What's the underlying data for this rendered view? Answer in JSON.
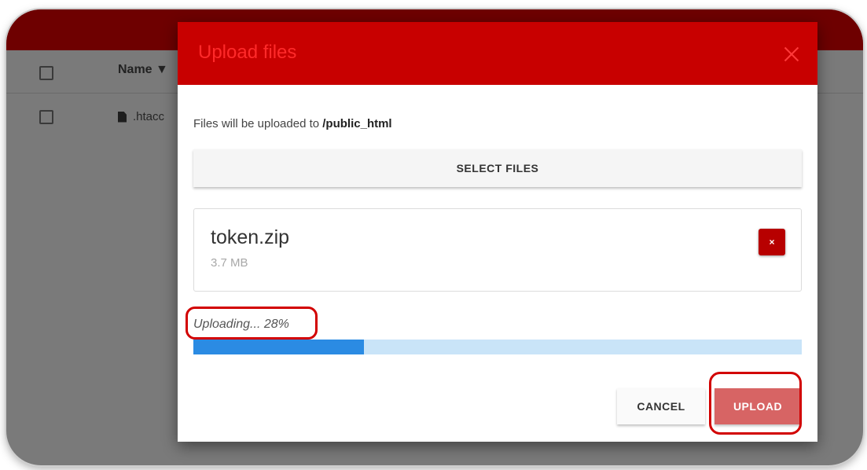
{
  "background": {
    "column_header_name": "Name ▼",
    "rows": [
      {
        "name": ".htacc"
      }
    ]
  },
  "modal": {
    "title": "Upload files",
    "destination_prefix": "Files will be uploaded to ",
    "destination_path": "/public_html",
    "select_files_label": "SELECT FILES",
    "file": {
      "name": "token.zip",
      "size": "3.7 MB",
      "remove_label": "×"
    },
    "status": "Uploading... 28%",
    "progress_percent": 28,
    "cancel_label": "CANCEL",
    "upload_label": "UPLOAD"
  },
  "colors": {
    "header_red": "#c80000",
    "progress_fill": "#2b8be3",
    "progress_track": "#c9e4f8",
    "upload_button": "#d76464",
    "annotation_red": "#d20000"
  },
  "icons": {
    "close": "close-icon",
    "file": "file-icon",
    "remove": "remove-icon"
  }
}
